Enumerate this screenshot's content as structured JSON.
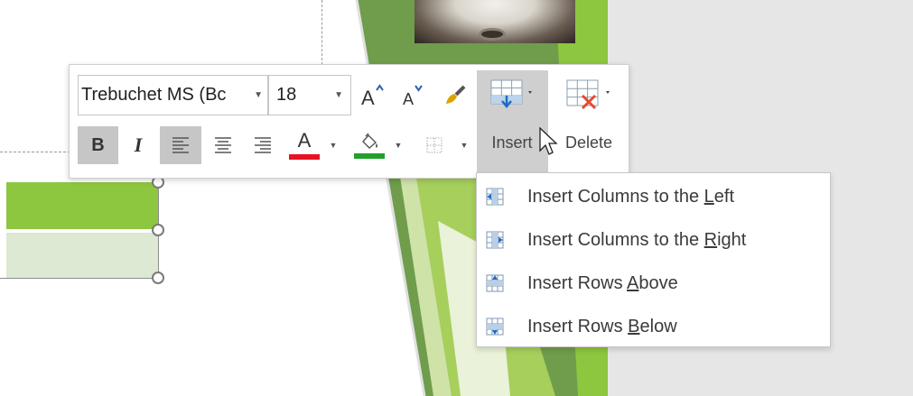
{
  "toolbar": {
    "font_name": "Trebuchet MS (Bc",
    "font_size": "18",
    "bold_label": "B",
    "italic_label": "I",
    "font_color_label": "A",
    "font_color": "#e81123",
    "highlight_color": "#22a029",
    "insert_label": "Insert",
    "delete_label": "Delete",
    "icons": [
      "increase-font-size-icon",
      "decrease-font-size-icon",
      "format-painter-icon",
      "align-left-icon",
      "align-center-icon",
      "align-right-icon",
      "font-color-icon",
      "shape-fill-icon",
      "borders-icon",
      "insert-table-icon",
      "delete-table-icon"
    ]
  },
  "insert_menu": {
    "items": [
      {
        "prefix": "Insert Columns to the ",
        "accel": "L",
        "suffix": "eft",
        "icon": "insert-columns-left-icon"
      },
      {
        "prefix": "Insert Columns to the ",
        "accel": "R",
        "suffix": "ight",
        "icon": "insert-columns-right-icon"
      },
      {
        "prefix": "Insert Rows ",
        "accel": "A",
        "suffix": "bove",
        "icon": "insert-rows-above-icon"
      },
      {
        "prefix": "Insert Rows ",
        "accel": "B",
        "suffix": "elow",
        "icon": "insert-rows-below-icon"
      }
    ]
  },
  "colors": {
    "accent_green": "#8dc63f",
    "light_green": "#dde9d2",
    "dark_green": "#6a9a48"
  }
}
